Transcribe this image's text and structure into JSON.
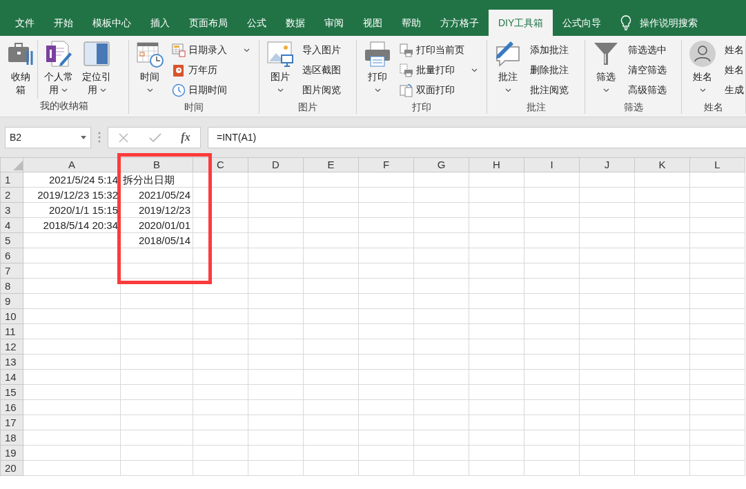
{
  "tabs": [
    {
      "label": "文件",
      "selected": false
    },
    {
      "label": "开始",
      "selected": false
    },
    {
      "label": "模板中心",
      "selected": false
    },
    {
      "label": "插入",
      "selected": false
    },
    {
      "label": "页面布局",
      "selected": false
    },
    {
      "label": "公式",
      "selected": false
    },
    {
      "label": "数据",
      "selected": false
    },
    {
      "label": "审阅",
      "selected": false
    },
    {
      "label": "视图",
      "selected": false
    },
    {
      "label": "帮助",
      "selected": false
    },
    {
      "label": "方方格子",
      "selected": false
    },
    {
      "label": "DIY工具箱",
      "selected": true
    },
    {
      "label": "公式向导",
      "selected": false
    }
  ],
  "tell_me": {
    "label": "操作说明搜索"
  },
  "ribbon": {
    "groups": [
      {
        "label": "我的收纳箱",
        "large_buttons": [
          {
            "label": "收纳箱",
            "dropdown": false
          },
          {
            "label": "个人常用",
            "dropdown": true
          },
          {
            "label": "定位引用",
            "dropdown": true
          }
        ]
      },
      {
        "label": "时间",
        "large_buttons": [
          {
            "label": "时间",
            "dropdown": true
          }
        ],
        "small_buttons": [
          {
            "label": "日期录入",
            "dropdown": true
          },
          {
            "label": "万年历",
            "dropdown": false
          },
          {
            "label": "日期时间",
            "dropdown": false
          }
        ]
      },
      {
        "label": "图片",
        "large_buttons": [
          {
            "label": "图片",
            "dropdown": true
          }
        ],
        "small_buttons": [
          {
            "label": "导入图片",
            "dropdown": false
          },
          {
            "label": "选区截图",
            "dropdown": false
          },
          {
            "label": "图片阅览",
            "dropdown": false
          }
        ]
      },
      {
        "label": "打印",
        "large_buttons": [
          {
            "label": "打印",
            "dropdown": true
          }
        ],
        "small_buttons": [
          {
            "label": "打印当前页",
            "dropdown": false
          },
          {
            "label": "批量打印",
            "dropdown": true
          },
          {
            "label": "双面打印",
            "dropdown": false
          }
        ]
      },
      {
        "label": "批注",
        "large_buttons": [
          {
            "label": "批注",
            "dropdown": true
          }
        ],
        "small_buttons": [
          {
            "label": "添加批注",
            "dropdown": false
          },
          {
            "label": "删除批注",
            "dropdown": false
          },
          {
            "label": "批注阅览",
            "dropdown": false
          }
        ]
      },
      {
        "label": "筛选",
        "large_buttons": [
          {
            "label": "筛选",
            "dropdown": true
          }
        ],
        "small_buttons": [
          {
            "label": "筛选选中",
            "dropdown": false
          },
          {
            "label": "清空筛选",
            "dropdown": false
          },
          {
            "label": "高级筛选",
            "dropdown": false
          }
        ]
      },
      {
        "label": "姓名",
        "large_buttons": [
          {
            "label": "姓名",
            "dropdown": true
          }
        ],
        "small_buttons": [
          {
            "label": "姓名",
            "dropdown": false
          },
          {
            "label": "姓名",
            "dropdown": false
          },
          {
            "label": "生成",
            "dropdown": false
          }
        ]
      }
    ]
  },
  "formula_bar": {
    "name_box": "B2",
    "function_label": "fx",
    "formula": "=INT(A1)"
  },
  "grid": {
    "columns": [
      "A",
      "B",
      "C",
      "D",
      "E",
      "F",
      "G",
      "H",
      "I",
      "J",
      "K",
      "L"
    ],
    "rows": [
      {
        "number": "1",
        "cells": [
          {
            "text": "2021/5/24 5:14",
            "kind": "number"
          },
          {
            "text": "拆分出日期",
            "kind": "text"
          }
        ]
      },
      {
        "number": "2",
        "cells": [
          {
            "text": "2019/12/23 15:32",
            "kind": "number"
          },
          {
            "text": "2021/05/24",
            "kind": "number"
          }
        ]
      },
      {
        "number": "3",
        "cells": [
          {
            "text": "2020/1/1 15:15",
            "kind": "number"
          },
          {
            "text": "2019/12/23",
            "kind": "number"
          }
        ]
      },
      {
        "number": "4",
        "cells": [
          {
            "text": "2018/5/14 20:34",
            "kind": "number"
          },
          {
            "text": "2020/01/01",
            "kind": "number"
          }
        ]
      },
      {
        "number": "5",
        "cells": [
          null,
          {
            "text": "2018/05/14",
            "kind": "number"
          }
        ]
      },
      {
        "number": "6"
      },
      {
        "number": "7"
      },
      {
        "number": "8"
      },
      {
        "number": "9"
      },
      {
        "number": "10"
      },
      {
        "number": "11"
      },
      {
        "number": "12"
      },
      {
        "number": "13"
      },
      {
        "number": "14"
      },
      {
        "number": "15"
      },
      {
        "number": "16"
      },
      {
        "number": "17"
      },
      {
        "number": "18"
      },
      {
        "number": "19"
      },
      {
        "number": "20"
      }
    ]
  }
}
